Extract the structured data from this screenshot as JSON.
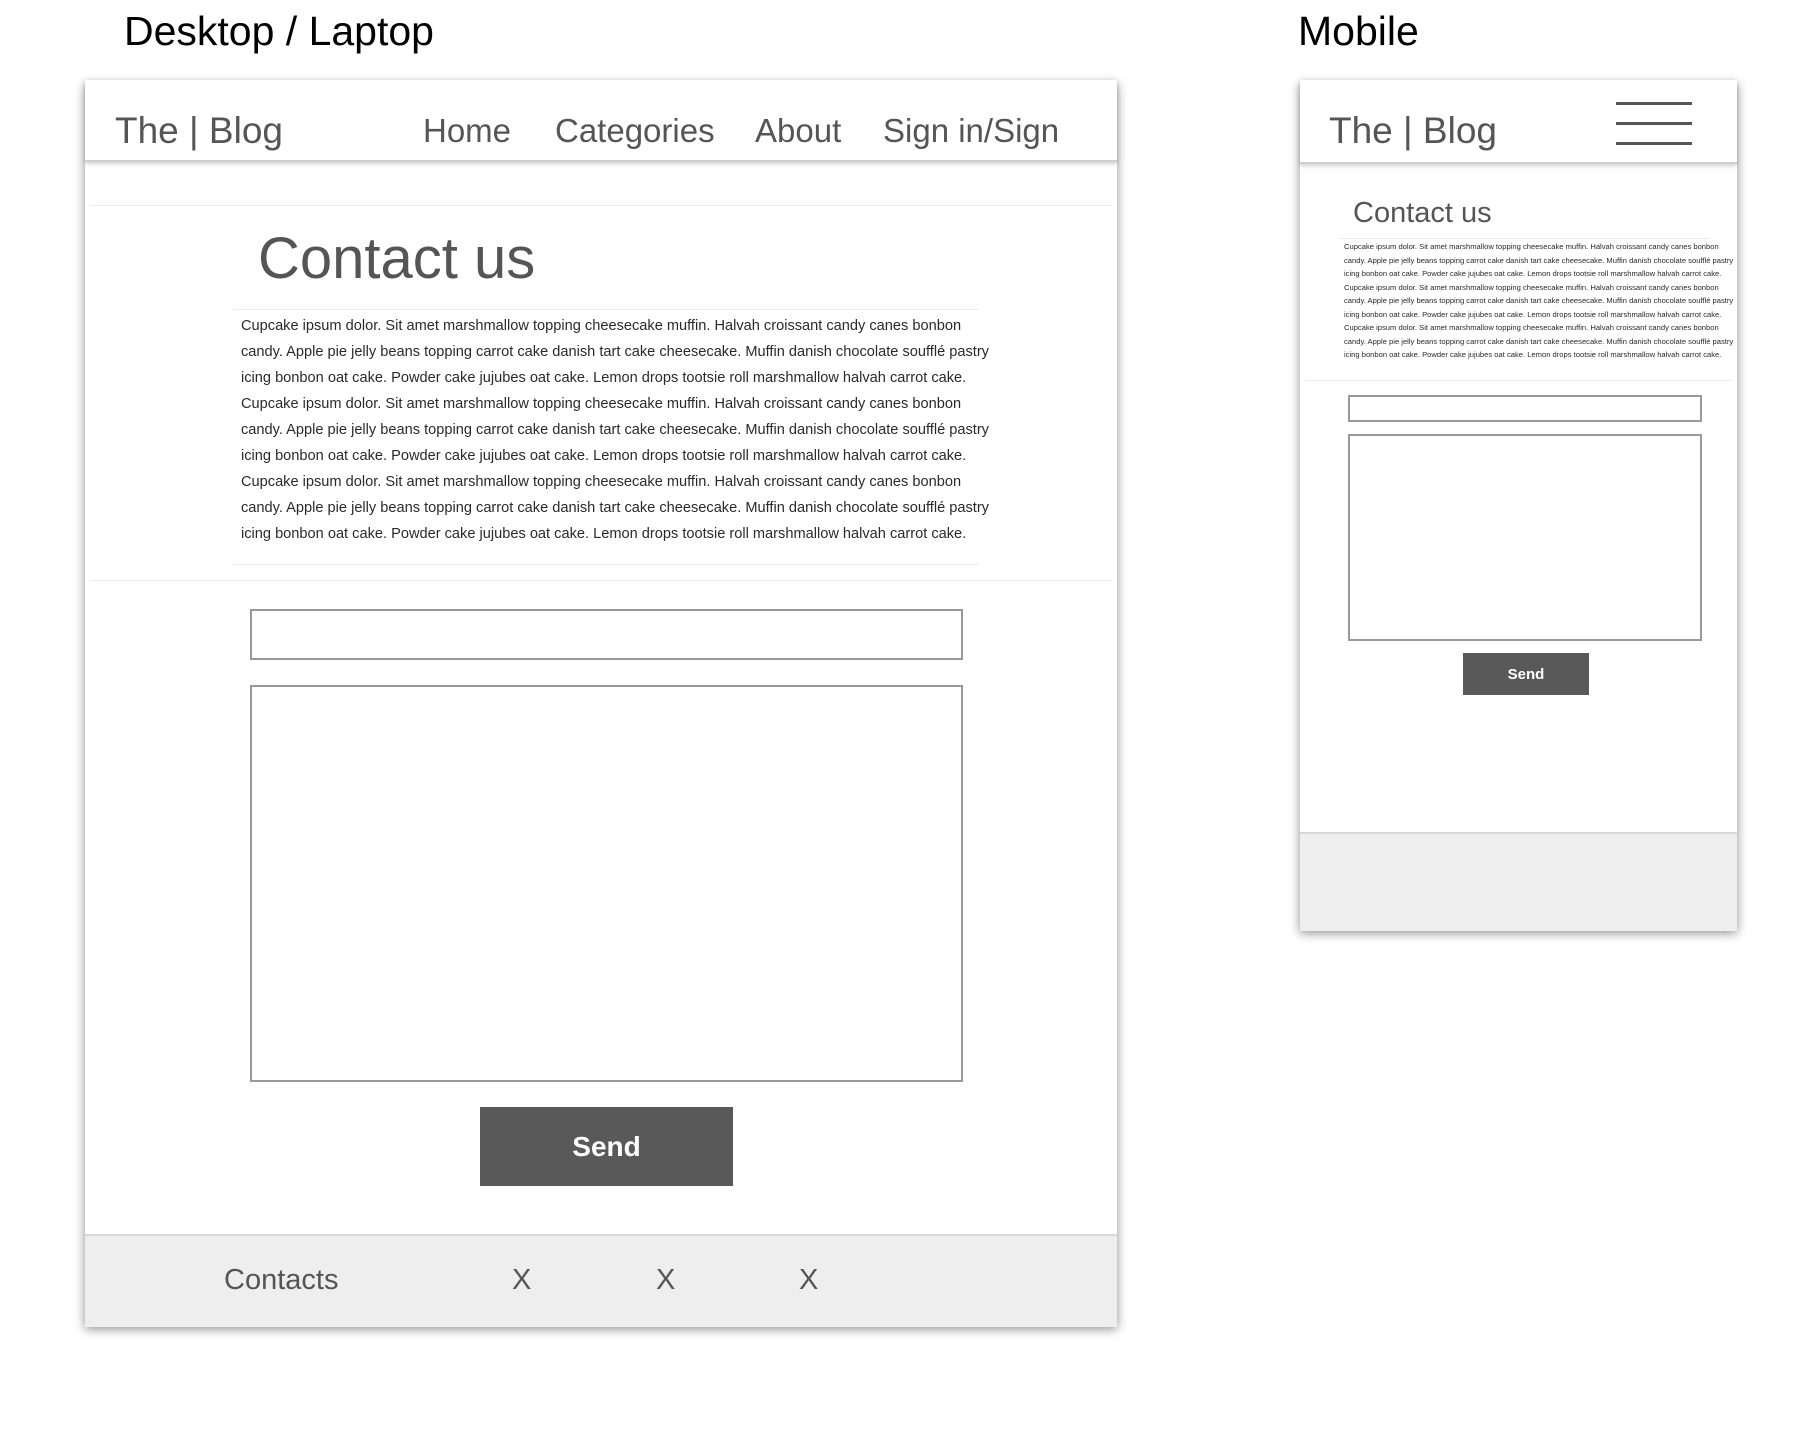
{
  "labels": {
    "desktop": "Desktop / Laptop",
    "mobile": "Mobile"
  },
  "desktop": {
    "brand": "The | Blog",
    "nav": [
      "Home",
      "Categories",
      "About",
      "Sign in/Sign"
    ],
    "heading": "Contact us",
    "body_lines": [
      "Cupcake ipsum dolor. Sit amet marshmallow topping cheesecake muffin. Halvah croissant candy canes bonbon",
      "candy. Apple pie jelly beans topping carrot cake danish tart cake cheesecake. Muffin danish chocolate soufflé pastry",
      "icing bonbon oat cake. Powder cake jujubes oat cake. Lemon drops tootsie roll marshmallow halvah carrot cake.",
      "Cupcake ipsum dolor. Sit amet marshmallow topping cheesecake muffin. Halvah croissant candy canes bonbon",
      "candy. Apple pie jelly beans topping carrot cake danish tart cake cheesecake. Muffin danish chocolate soufflé pastry",
      "icing bonbon oat cake. Powder cake jujubes oat cake. Lemon drops tootsie roll marshmallow halvah carrot cake.",
      "Cupcake ipsum dolor. Sit amet marshmallow topping cheesecake muffin. Halvah croissant candy canes bonbon",
      "candy. Apple pie jelly beans topping carrot cake danish tart cake cheesecake. Muffin danish chocolate soufflé pastry",
      "icing bonbon oat cake. Powder cake jujubes oat cake. Lemon drops tootsie roll marshmallow halvah carrot cake."
    ],
    "subject_value": "",
    "message_value": "",
    "send_label": "Send",
    "footer": [
      "Contacts",
      "X",
      "X",
      "X"
    ]
  },
  "mobile": {
    "brand": "The | Blog",
    "menu_icon": "hamburger-menu-icon",
    "heading": "Contact us",
    "body_lines": [
      "Cupcake ipsum dolor. Sit amet marshmallow topping cheesecake muffin. Halvah croissant candy canes bonbon",
      "candy. Apple pie jelly beans topping carrot cake danish tart cake cheesecake. Muffin danish chocolate soufflé pastry",
      "icing bonbon oat cake. Powder cake jujubes oat cake. Lemon drops tootsie roll marshmallow halvah carrot cake.",
      "Cupcake ipsum dolor. Sit amet marshmallow topping cheesecake muffin. Halvah croissant candy canes bonbon",
      "candy. Apple pie jelly beans topping carrot cake danish tart cake cheesecake. Muffin danish chocolate soufflé pastry",
      "icing bonbon oat cake. Powder cake jujubes oat cake. Lemon drops tootsie roll marshmallow halvah carrot cake.",
      "Cupcake ipsum dolor. Sit amet marshmallow topping cheesecake muffin. Halvah croissant candy canes bonbon",
      "candy. Apple pie jelly beans topping carrot cake danish tart cake cheesecake. Muffin danish chocolate soufflé pastry",
      "icing bonbon oat cake. Powder cake jujubes oat cake. Lemon drops tootsie roll marshmallow halvah carrot cake."
    ],
    "subject_value": "",
    "message_value": "",
    "send_label": "Send"
  },
  "colors": {
    "button": "#595959",
    "footer": "#eeeeee",
    "text": "#555555",
    "field_border": "#999999"
  }
}
